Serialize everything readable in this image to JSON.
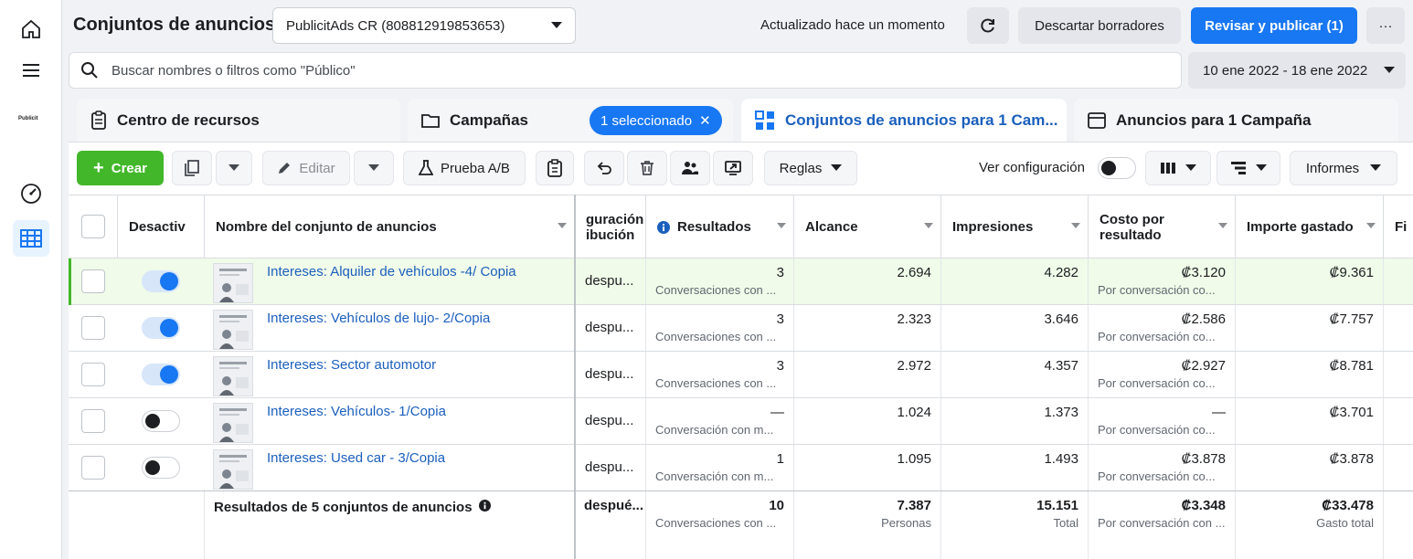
{
  "header": {
    "title": "Conjuntos de anuncios",
    "account": "PublicitAds CR (808812919853653)",
    "updated": "Actualizado hace un momento",
    "discard": "Descartar borradores",
    "publish": "Revisar y publicar (1)",
    "more": "···"
  },
  "rail": {
    "logo_text": "Publicit"
  },
  "search": {
    "placeholder": "Buscar nombres o filtros como \"Público\""
  },
  "date_range": "10 ene 2022 - 18 ene 2022",
  "tabs": [
    {
      "label": "Centro de recursos"
    },
    {
      "label": "Campañas"
    },
    {
      "label": "Conjuntos de anuncios para 1 Cam..."
    },
    {
      "label": "Anuncios para 1 Campaña"
    }
  ],
  "selected_chip": "1 seleccionado",
  "toolbar": {
    "create": "Crear",
    "edit": "Editar",
    "ab_test": "Prueba A/B",
    "rules": "Reglas",
    "ver_config": "Ver configuración",
    "reports": "Informes"
  },
  "table": {
    "headers": {
      "deactivate": "Desactiv",
      "name": "Nombre del conjunto de anuncios",
      "attribution_1": "guración",
      "attribution_2": "ibución",
      "results": "Resultados",
      "reach": "Alcance",
      "impressions": "Impresiones",
      "cpr_1": "Costo por",
      "cpr_2": "resultado",
      "spent": "Importe gastado",
      "next": "Fi"
    },
    "rows": [
      {
        "on": true,
        "name": "Intereses: Alquiler de vehículos -4/ Copia",
        "attribution": "despu...",
        "results": "3",
        "results_sub": "Conversaciones con ...",
        "reach": "2.694",
        "impressions": "4.282",
        "cpr": "₡3.120",
        "cpr_sub": "Por conversación co...",
        "spent": "₡9.361"
      },
      {
        "on": true,
        "name": "Intereses: Vehículos de lujo- 2/Copia",
        "attribution": "despu...",
        "results": "3",
        "results_sub": "Conversaciones con ...",
        "reach": "2.323",
        "impressions": "3.646",
        "cpr": "₡2.586",
        "cpr_sub": "Por conversación co...",
        "spent": "₡7.757"
      },
      {
        "on": true,
        "name": "Intereses: Sector automotor",
        "attribution": "despu...",
        "results": "3",
        "results_sub": "Conversaciones con ...",
        "reach": "2.972",
        "impressions": "4.357",
        "cpr": "₡2.927",
        "cpr_sub": "Por conversación co...",
        "spent": "₡8.781"
      },
      {
        "on": false,
        "name": "Intereses: Vehículos- 1/Copia",
        "attribution": "despu...",
        "results": "—",
        "results_sub": "Conversación con m...",
        "reach": "1.024",
        "impressions": "1.373",
        "cpr": "—",
        "cpr_sub": "Por conversación co...",
        "spent": "₡3.701"
      },
      {
        "on": false,
        "name": "Intereses: Used car - 3/Copia",
        "attribution": "despu...",
        "results": "1",
        "results_sub": "Conversación con m...",
        "reach": "1.095",
        "impressions": "1.493",
        "cpr": "₡3.878",
        "cpr_sub": "Por conversación co...",
        "spent": "₡3.878"
      }
    ],
    "summary": {
      "label": "Resultados de 5 conjuntos de anuncios",
      "attribution": "despué...",
      "results": "10",
      "results_sub": "Conversaciones con ...",
      "reach": "7.387",
      "reach_sub": "Personas",
      "impressions": "15.151",
      "impressions_sub": "Total",
      "cpr": "₡3.348",
      "cpr_sub": "Por conversación con ...",
      "spent": "₡33.478",
      "spent_sub": "Gasto total"
    }
  },
  "colors": {
    "accent": "#1877f2",
    "create": "#42b72a",
    "link": "#1b5fbd",
    "highlight": "#f0fbe9"
  }
}
